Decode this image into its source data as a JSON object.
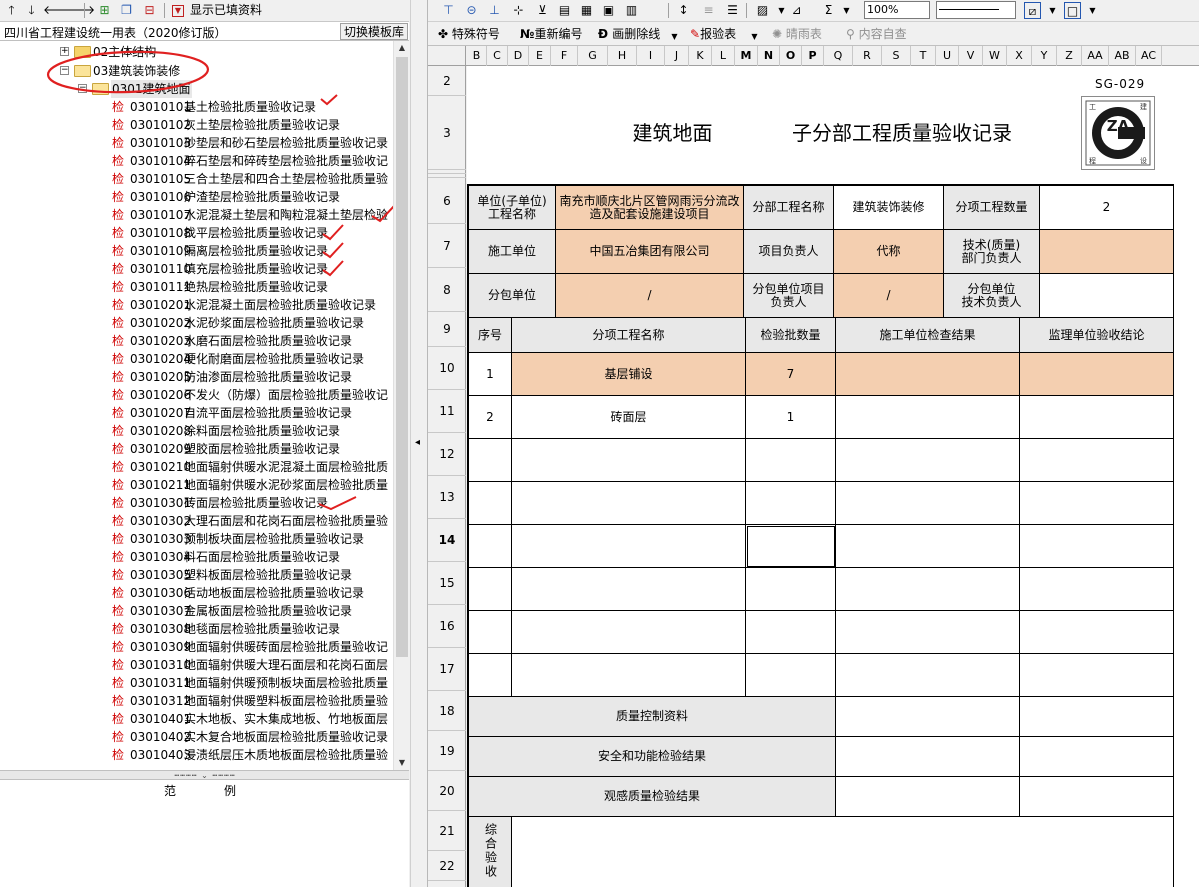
{
  "left_toolbar": {
    "buttons": [
      {
        "icon": "arrow-up-icon",
        "glyph": "🡑"
      },
      {
        "icon": "arrow-down-icon",
        "glyph": "🡓"
      },
      {
        "icon": "arrow-left-icon",
        "glyph": "🡐"
      },
      {
        "icon": "arrow-right-icon",
        "glyph": "🡒"
      },
      {
        "icon": "add-icon",
        "glyph": "⊞"
      },
      {
        "icon": "copy-icon",
        "glyph": "❐"
      },
      {
        "icon": "delete-icon",
        "glyph": "⊟"
      }
    ],
    "filter_label": "显示已填资料"
  },
  "left_header": {
    "template_title": "四川省工程建设统一用表（2020修订版）",
    "switch_button": "切换模板库"
  },
  "tree": {
    "nodes": [
      {
        "label": "02主体结构",
        "toggle": "+"
      },
      {
        "label": "03建筑装饰装修",
        "toggle": "−"
      },
      {
        "label": "0301建筑地面",
        "toggle": "−"
      }
    ],
    "check_glyph": "检",
    "items": [
      {
        "code": "03010101",
        "name": "基土检验批质量验收记录"
      },
      {
        "code": "03010102",
        "name": "灰土垫层检验批质量验收记录"
      },
      {
        "code": "03010103",
        "name": "砂垫层和砂石垫层检验批质量验收记录"
      },
      {
        "code": "03010104",
        "name": "碎石垫层和碎砖垫层检验批质量验收记"
      },
      {
        "code": "03010105",
        "name": "三合土垫层和四合土垫层检验批质量验"
      },
      {
        "code": "03010106",
        "name": "炉渣垫层检验批质量验收记录"
      },
      {
        "code": "03010107",
        "name": "水泥混凝土垫层和陶粒混凝土垫层检验"
      },
      {
        "code": "03010108",
        "name": "找平层检验批质量验收记录"
      },
      {
        "code": "03010109",
        "name": "隔离层检验批质量验收记录"
      },
      {
        "code": "03010110",
        "name": "填充层检验批质量验收记录"
      },
      {
        "code": "03010111",
        "name": "绝热层检验批质量验收记录"
      },
      {
        "code": "03010201",
        "name": "水泥混凝土面层检验批质量验收记录"
      },
      {
        "code": "03010202",
        "name": "水泥砂浆面层检验批质量验收记录"
      },
      {
        "code": "03010203",
        "name": "水磨石面层检验批质量验收记录"
      },
      {
        "code": "03010204",
        "name": "硬化耐磨面层检验批质量验收记录"
      },
      {
        "code": "03010205",
        "name": "防油渗面层检验批质量验收记录"
      },
      {
        "code": "03010206",
        "name": "不发火（防爆）面层检验批质量验收记"
      },
      {
        "code": "03010207",
        "name": "自流平面层检验批质量验收记录"
      },
      {
        "code": "03010208",
        "name": "涂料面层检验批质量验收记录"
      },
      {
        "code": "03010209",
        "name": "塑胶面层检验批质量验收记录"
      },
      {
        "code": "03010210",
        "name": "地面辐射供暖水泥混凝土面层检验批质"
      },
      {
        "code": "03010211",
        "name": "地面辐射供暖水泥砂浆面层检验批质量"
      },
      {
        "code": "03010301",
        "name": "砖面层检验批质量验收记录"
      },
      {
        "code": "03010302",
        "name": "大理石面层和花岗石面层检验批质量验"
      },
      {
        "code": "03010303",
        "name": "预制板块面层检验批质量验收记录"
      },
      {
        "code": "03010304",
        "name": "料石面层检验批质量验收记录"
      },
      {
        "code": "03010305",
        "name": "塑料板面层检验批质量验收记录"
      },
      {
        "code": "03010306",
        "name": "活动地板面层检验批质量验收记录"
      },
      {
        "code": "03010307",
        "name": "金属板面层检验批质量验收记录"
      },
      {
        "code": "03010308",
        "name": "地毯面层检验批质量验收记录"
      },
      {
        "code": "03010309",
        "name": "地面辐射供暖砖面层检验批质量验收记"
      },
      {
        "code": "03010310",
        "name": "地面辐射供暖大理石面层和花岗石面层"
      },
      {
        "code": "03010311",
        "name": "地面辐射供暖预制板块面层检验批质量"
      },
      {
        "code": "03010312",
        "name": "地面辐射供暖塑料板面层检验批质量验"
      },
      {
        "code": "03010401",
        "name": "实木地板、实木集成地板、竹地板面层"
      },
      {
        "code": "03010402",
        "name": "实木复合地板面层检验批质量验收记录"
      },
      {
        "code": "03010403",
        "name": "浸渍纸层压木质地板面层检验批质量验"
      }
    ]
  },
  "example_panel": {
    "title": "范例"
  },
  "toolbar2": {
    "special_symbol": "特殊符号",
    "renumber": "重新编号",
    "strikeout": "画删除线",
    "report": "报验表",
    "weather": "晴雨表",
    "self_check": "内容自查",
    "zoom": "100%"
  },
  "columns": [
    "B",
    "C",
    "D",
    "E",
    "F",
    "G",
    "H",
    "I",
    "J",
    "K",
    "L",
    "M",
    "N",
    "O",
    "P",
    "Q",
    "R",
    "S",
    "T",
    "U",
    "V",
    "W",
    "X",
    "Y",
    "Z",
    "AA",
    "AB",
    "AC"
  ],
  "bold_columns": [
    "M",
    "N",
    "O",
    "P"
  ],
  "rows": [
    "2",
    "3",
    "4",
    "5",
    "6",
    "7",
    "8",
    "9",
    "10",
    "11",
    "12",
    "13",
    "14",
    "15",
    "16",
    "17",
    "18",
    "19",
    "20",
    "21",
    "22"
  ],
  "form": {
    "code": "SG-029",
    "title_left": "建筑地面",
    "title_right": "子分部工程质量验收记录",
    "logo_text": "ZA",
    "logo_corner_tl": "工",
    "logo_corner_tr": "建",
    "logo_corner_bl": "程",
    "logo_corner_br": "设",
    "unit_label": "单位(子单位)\n工程名称",
    "unit_value": "南充市顺庆北片区管网雨污分流改造及配套设施建设项目",
    "sub_project_label": "分部工程名称",
    "sub_project_value": "建筑装饰装修",
    "item_count_label": "分项工程数量",
    "item_count_value": "2",
    "construction_label": "施工单位",
    "construction_value": "中国五冶集团有限公司",
    "pm_label": "项目负责人",
    "pm_value": "代称",
    "tech_label": "技术(质量)\n部门负责人",
    "tech_value": "",
    "sub_contract_label": "分包单位",
    "sub_contract_value": "/",
    "sub_pm_label": "分包单位项目\n负责人",
    "sub_pm_value": "/",
    "sub_tech_label": "分包单位\n技术负责人",
    "sub_tech_value": "",
    "head_seq": "序号",
    "head_name": "分项工程名称",
    "head_count": "检验批数量",
    "head_result": "施工单位检查结果",
    "head_supervision": "监理单位验收结论",
    "lines": [
      {
        "seq": "1",
        "name": "基层铺设",
        "count": "7"
      },
      {
        "seq": "2",
        "name": "砖面层",
        "count": "1"
      }
    ],
    "quality_docs": "质量控制资料",
    "safety_results": "安全和功能检验结果",
    "appearance_results": "观感质量检验结果",
    "conclusion_label": "综合验收"
  }
}
